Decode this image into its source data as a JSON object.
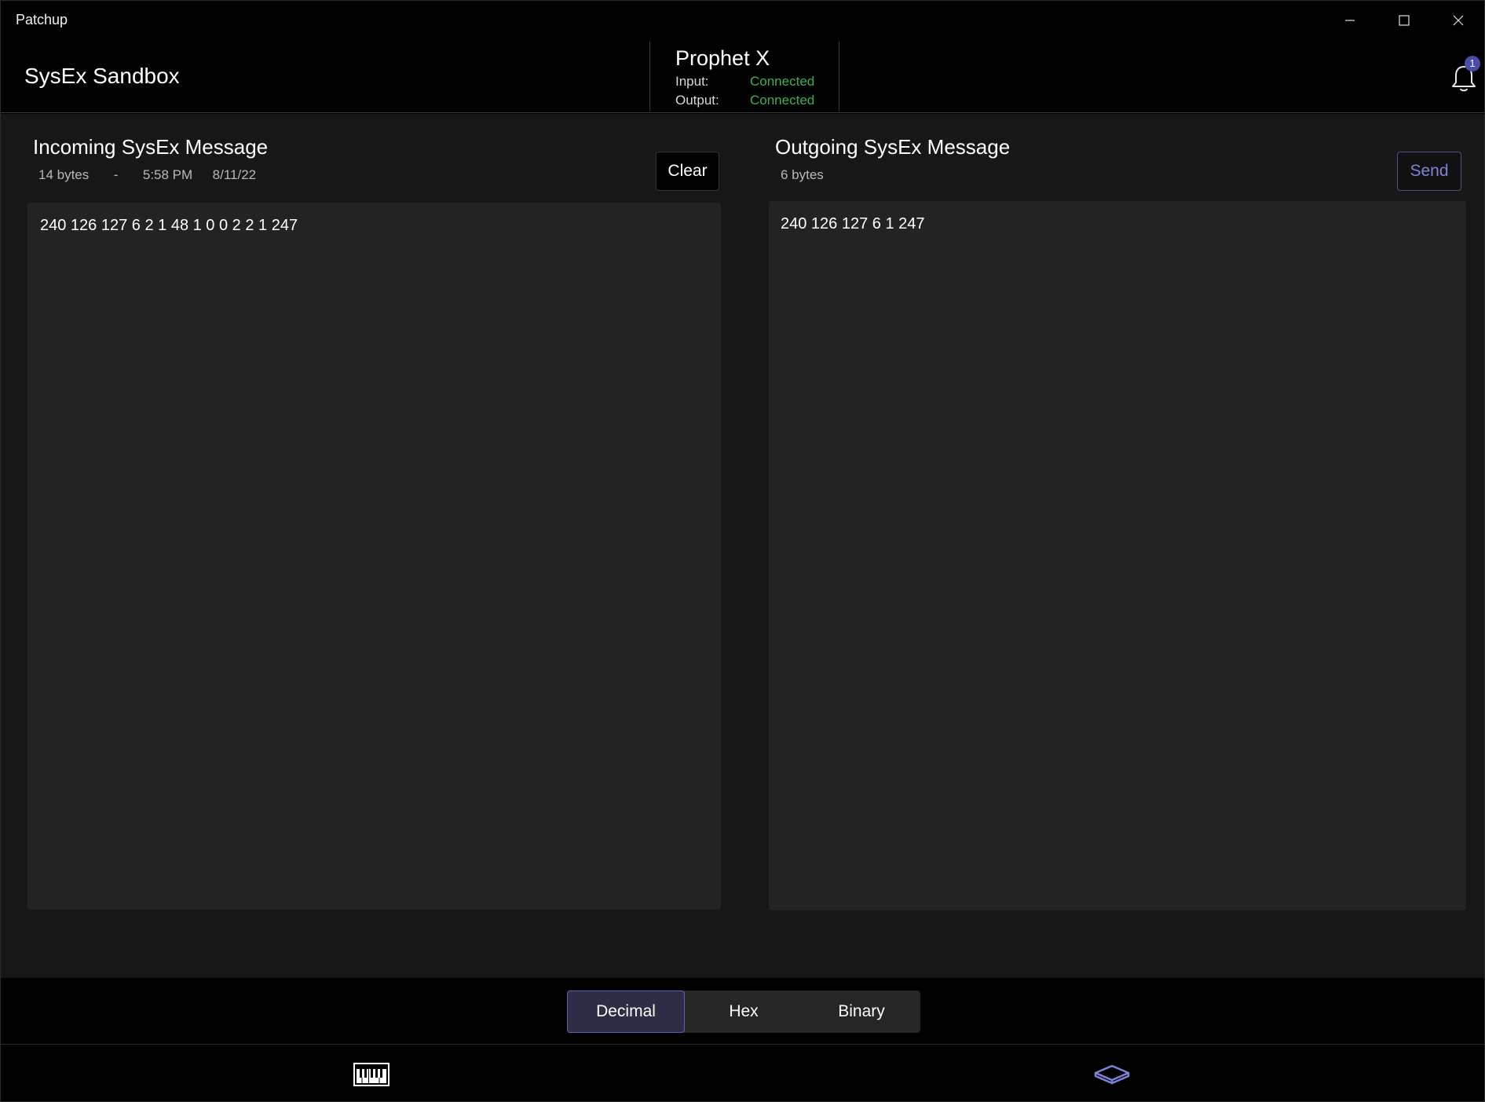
{
  "window": {
    "title": "Patchup"
  },
  "header": {
    "page_title": "SysEx Sandbox",
    "device": {
      "name": "Prophet X",
      "input_label": "Input:",
      "input_status": "Connected",
      "output_label": "Output:",
      "output_status": "Connected"
    },
    "notifications": {
      "count": "1"
    }
  },
  "incoming": {
    "title": "Incoming SysEx Message",
    "byte_count": "14 bytes",
    "separator": "-",
    "time": "5:58 PM",
    "date": "8/11/22",
    "clear_label": "Clear",
    "message": "240 126 127 6 2 1 48 1 0 0 2 2 1 247"
  },
  "outgoing": {
    "title": "Outgoing SysEx Message",
    "byte_count": "6 bytes",
    "send_label": "Send",
    "message": "240 126 127 6 1 247"
  },
  "format_selector": {
    "options": [
      "Decimal",
      "Hex",
      "Binary"
    ],
    "selected": "Decimal"
  },
  "colors": {
    "accent": "#5c60c4",
    "connected": "#3fae52",
    "badge": "#4a4ca8",
    "send_text": "#7f83d8"
  },
  "icons": {
    "bell": "bell-icon",
    "keyboard": "piano-keyboard-icon",
    "sandbox": "sandbox-box-icon"
  }
}
